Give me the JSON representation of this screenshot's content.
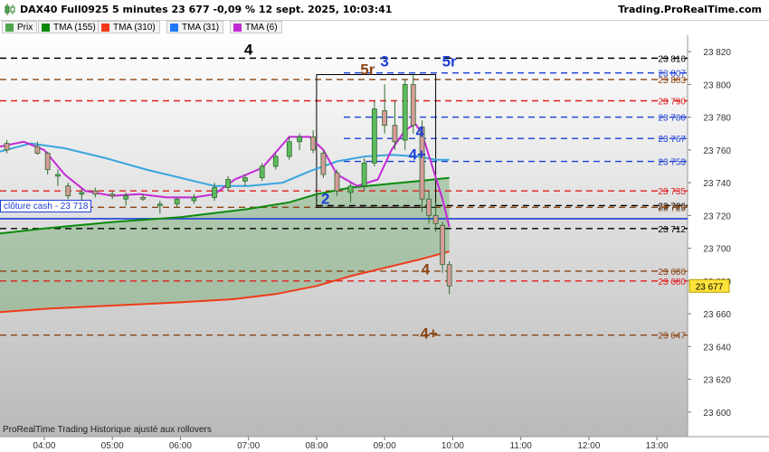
{
  "header": {
    "title": "DAX40 Full0925 5 minutes 23 677 -0,09 % 12 sept. 2025, 10:03:41",
    "brand": "Trading.ProRealTime.com"
  },
  "legend": [
    {
      "label": "Prix",
      "color": "#4fa64f"
    },
    {
      "label": "TMA (155)",
      "color": "#0c8a0c"
    },
    {
      "label": "TMA (310)",
      "color": "#f03a17"
    },
    {
      "label": "TMA (31)",
      "color": "#1f78ff"
    },
    {
      "label": "TMA (6)",
      "color": "#c32ad6"
    }
  ],
  "footer": "ProRealTime Trading  Historique ajusté aux rollovers",
  "cloture": "clôture cash -  23 718",
  "chart_data": {
    "type": "candlestick",
    "ylim": [
      23585,
      23830
    ],
    "xlim": [
      3.35,
      13.45
    ],
    "y_ticks": [
      23600,
      23620,
      23640,
      23660,
      23680,
      23700,
      23720,
      23740,
      23760,
      23780,
      23800,
      23820
    ],
    "y_tick_labels": [
      "23 600",
      "23 620",
      "23 640",
      "23 660",
      "23 680",
      "23 700",
      "23 720",
      "23 740",
      "23 760",
      "23 780",
      "23 800",
      "23 820"
    ],
    "x_ticks": [
      4,
      5,
      6,
      7,
      8,
      9,
      10,
      11,
      12,
      13
    ],
    "x_tick_labels": [
      "04:00",
      "05:00",
      "06:00",
      "07:00",
      "08:00",
      "09:00",
      "10:00",
      "11:00",
      "12:00",
      "13:00"
    ],
    "last_price": {
      "value": 23677,
      "label": "23 677"
    },
    "close_cash_level": 23718,
    "levels": [
      {
        "value": 23816,
        "label": "23 816",
        "color": "#000000",
        "xstart": 3.35
      },
      {
        "value": 23807,
        "label": "23 807",
        "color": "#1d3fd6",
        "xstart": 8.4
      },
      {
        "value": 23803,
        "label": "23 803",
        "color": "#8b4513",
        "xstart": 3.35
      },
      {
        "value": 23790,
        "label": "23 790",
        "color": "#e02020",
        "xstart": 3.35
      },
      {
        "value": 23780,
        "label": "23 780",
        "color": "#1d3fd6",
        "xstart": 8.4
      },
      {
        "value": 23767,
        "label": "23 767",
        "color": "#1d3fd6",
        "xstart": 8.4
      },
      {
        "value": 23753,
        "label": "23 753",
        "color": "#1d3fd6",
        "xstart": 8.4
      },
      {
        "value": 23735,
        "label": "23 735",
        "color": "#e02020",
        "xstart": 3.35
      },
      {
        "value": 23726,
        "label": "23 726",
        "color": "#000000",
        "xstart": 8.0
      },
      {
        "value": 23725,
        "label": "23 725",
        "color": "#8b4513",
        "xstart": 3.35
      },
      {
        "value": 23712,
        "label": "23 712",
        "color": "#000000",
        "xstart": 3.35
      },
      {
        "value": 23686,
        "label": "23 686",
        "color": "#8b4513",
        "xstart": 3.35
      },
      {
        "value": 23680,
        "label": "23 680",
        "color": "#e02020",
        "xstart": 3.35
      },
      {
        "value": 23647,
        "label": "23 647",
        "color": "#8b4513",
        "xstart": 3.35
      }
    ],
    "wave_labels": [
      {
        "text": "4",
        "x": 7.0,
        "y": 23818,
        "color": "#000000"
      },
      {
        "text": "5r",
        "x": 8.75,
        "y": 23806,
        "color": "#8b4513"
      },
      {
        "text": "3",
        "x": 9.0,
        "y": 23811,
        "color": "#1d3fd6"
      },
      {
        "text": "5r",
        "x": 9.95,
        "y": 23811,
        "color": "#1d3fd6"
      },
      {
        "text": "4",
        "x": 9.52,
        "y": 23768,
        "color": "#1d3fd6"
      },
      {
        "text": "4+",
        "x": 9.48,
        "y": 23754,
        "color": "#1d3fd6"
      },
      {
        "text": "2",
        "x": 8.13,
        "y": 23727,
        "color": "#1d3fd6"
      },
      {
        "text": "4",
        "x": 9.6,
        "y": 23684,
        "color": "#8b4513"
      },
      {
        "text": "4+",
        "x": 9.65,
        "y": 23645,
        "color": "#8b4513"
      }
    ],
    "box": {
      "x0": 8.0,
      "x1": 9.75,
      "y0": 23725,
      "y1": 23806
    },
    "series": [
      {
        "name": "TMA (310)",
        "color": "#f03a17",
        "points": [
          [
            3.35,
            23661
          ],
          [
            4.0,
            23663
          ],
          [
            5.0,
            23665
          ],
          [
            6.0,
            23667
          ],
          [
            6.8,
            23669
          ],
          [
            7.4,
            23672
          ],
          [
            8.0,
            23677
          ],
          [
            8.5,
            23683
          ],
          [
            9.0,
            23688
          ],
          [
            9.5,
            23693
          ],
          [
            9.95,
            23698
          ]
        ]
      },
      {
        "name": "TMA (155)",
        "color": "#0c8a0c",
        "points": [
          [
            3.35,
            23709
          ],
          [
            4.0,
            23712
          ],
          [
            5.0,
            23716
          ],
          [
            6.0,
            23719
          ],
          [
            7.0,
            23724
          ],
          [
            7.6,
            23728
          ],
          [
            8.0,
            23733
          ],
          [
            8.5,
            23737
          ],
          [
            9.0,
            23739
          ],
          [
            9.5,
            23741
          ],
          [
            9.95,
            23743
          ]
        ]
      },
      {
        "name": "TMA (31)",
        "color": "#3aa6dd",
        "points": [
          [
            3.35,
            23759
          ],
          [
            3.8,
            23764
          ],
          [
            4.3,
            23761
          ],
          [
            4.9,
            23755
          ],
          [
            5.5,
            23748
          ],
          [
            6.1,
            23742
          ],
          [
            6.5,
            23738
          ],
          [
            7.0,
            23738
          ],
          [
            7.5,
            23740
          ],
          [
            7.9,
            23747
          ],
          [
            8.3,
            23753
          ],
          [
            8.7,
            23756
          ],
          [
            9.1,
            23757
          ],
          [
            9.5,
            23756
          ],
          [
            9.75,
            23754
          ],
          [
            9.95,
            23754
          ]
        ]
      },
      {
        "name": "TMA (6)",
        "color": "#c32ad6",
        "points": [
          [
            3.35,
            23762
          ],
          [
            3.7,
            23765
          ],
          [
            4.0,
            23760
          ],
          [
            4.3,
            23745
          ],
          [
            4.6,
            23735
          ],
          [
            5.0,
            23732
          ],
          [
            5.4,
            23733
          ],
          [
            5.8,
            23731
          ],
          [
            6.2,
            23731
          ],
          [
            6.5,
            23733
          ],
          [
            6.8,
            23742
          ],
          [
            7.2,
            23749
          ],
          [
            7.6,
            23768
          ],
          [
            7.9,
            23768
          ],
          [
            8.1,
            23760
          ],
          [
            8.3,
            23745
          ],
          [
            8.6,
            23738
          ],
          [
            8.9,
            23742
          ],
          [
            9.1,
            23760
          ],
          [
            9.3,
            23772
          ],
          [
            9.45,
            23776
          ],
          [
            9.55,
            23770
          ],
          [
            9.7,
            23750
          ],
          [
            9.85,
            23730
          ],
          [
            9.95,
            23713
          ]
        ]
      }
    ],
    "candles": [
      [
        3.45,
        23764,
        23766,
        23758,
        23760
      ],
      [
        3.9,
        23762,
        23765,
        23757,
        23758
      ],
      [
        4.05,
        23758,
        23759,
        23745,
        23748
      ],
      [
        4.2,
        23744,
        23748,
        23738,
        23745
      ],
      [
        4.35,
        23738,
        23740,
        23730,
        23732
      ],
      [
        4.55,
        23733,
        23736,
        23729,
        23734
      ],
      [
        4.75,
        23735,
        23737,
        23731,
        23733
      ],
      [
        5.0,
        23733,
        23735,
        23730,
        23732
      ],
      [
        5.2,
        23730,
        23734,
        23726,
        23732
      ],
      [
        5.45,
        23731,
        23733,
        23729,
        23730
      ],
      [
        5.7,
        23726,
        23729,
        23721,
        23727
      ],
      [
        5.95,
        23727,
        23731,
        23725,
        23730
      ],
      [
        6.2,
        23729,
        23733,
        23727,
        23731
      ],
      [
        6.5,
        23731,
        23740,
        23729,
        23737
      ],
      [
        6.7,
        23737,
        23744,
        23735,
        23742
      ],
      [
        6.95,
        23741,
        23745,
        23738,
        23743
      ],
      [
        7.2,
        23743,
        23752,
        23741,
        23750
      ],
      [
        7.4,
        23750,
        23758,
        23748,
        23756
      ],
      [
        7.6,
        23756,
        23768,
        23754,
        23765
      ],
      [
        7.75,
        23765,
        23770,
        23760,
        23768
      ],
      [
        7.95,
        23768,
        23772,
        23758,
        23760
      ],
      [
        8.1,
        23758,
        23760,
        23743,
        23745
      ],
      [
        8.3,
        23746,
        23748,
        23732,
        23735
      ],
      [
        8.5,
        23734,
        23740,
        23728,
        23738
      ],
      [
        8.7,
        23738,
        23755,
        23735,
        23752
      ],
      [
        8.85,
        23752,
        23790,
        23750,
        23785
      ],
      [
        9.0,
        23784,
        23800,
        23770,
        23775
      ],
      [
        9.15,
        23775,
        23790,
        23760,
        23765
      ],
      [
        9.3,
        23766,
        23803,
        23760,
        23800
      ],
      [
        9.42,
        23800,
        23806,
        23770,
        23775
      ],
      [
        9.55,
        23774,
        23778,
        23722,
        23730
      ],
      [
        9.65,
        23730,
        23735,
        23715,
        23720
      ],
      [
        9.75,
        23720,
        23728,
        23710,
        23715
      ],
      [
        9.85,
        23714,
        23716,
        23685,
        23690
      ],
      [
        9.95,
        23690,
        23692,
        23672,
        23677
      ]
    ]
  }
}
